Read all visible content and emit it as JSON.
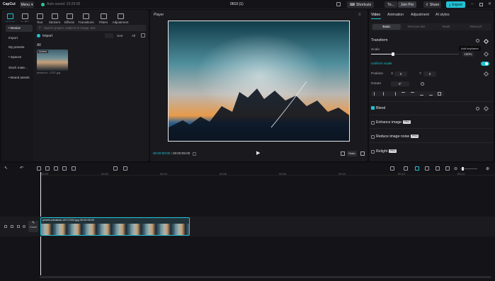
{
  "app": {
    "name": "CapCut",
    "menu_label": "Menu",
    "autosave": "Auto saved: 23:29:55",
    "project_title": "0610 (1)"
  },
  "topbar": {
    "shortcuts": "Shortcuts",
    "account": "To...",
    "join_pro": "Join Pro",
    "share": "Share",
    "export": "Export"
  },
  "media_tabs": [
    {
      "label": "Import"
    },
    {
      "label": "Audio"
    },
    {
      "label": "Text"
    },
    {
      "label": "Stickers"
    },
    {
      "label": "Effects"
    },
    {
      "label": "Transitions"
    },
    {
      "label": "Filters"
    },
    {
      "label": "Adjustment"
    }
  ],
  "sidebar": {
    "items": [
      "• Device",
      "Import",
      "My presets",
      "• Spaces",
      "Stock mate...",
      "• Brand assets"
    ]
  },
  "media": {
    "search_placeholder": "Search project, subjects in image, text",
    "import_label": "Import",
    "sort_label": "Sort",
    "filter_label": "All",
    "section_label": "All",
    "asset_badge": "Added",
    "asset_name": "pexels-m...0707.jpg"
  },
  "player": {
    "title": "Player",
    "time_current": "00:00:00:00",
    "time_total": "00:00:05:00",
    "ratio_label": "Ratio"
  },
  "props": {
    "tabs": [
      "Video",
      "Animation",
      "Adjustment",
      "AI styles"
    ],
    "subtabs": [
      "Basic",
      "Remove BG",
      "Mask",
      "Retouch"
    ],
    "transform_label": "Transform",
    "tooltip": "Add keyframe",
    "scale_label": "Scale",
    "scale_value": "100%",
    "scale_fraction": 0.25,
    "uniform_scale_label": "Uniform scale",
    "position_label": "Position",
    "pos_x": "0",
    "pos_y": "0",
    "pos_x_axis": "X",
    "pos_y_axis": "Y",
    "rotate_label": "Rotate",
    "rotate_value": "0°",
    "blend_label": "Blend",
    "enhance_label": "Enhance image",
    "noise_label": "Reduce image noise",
    "relight_label": "Relight",
    "pro_badge": "PRO"
  },
  "timeline": {
    "ruler": [
      "00:00",
      "00:02",
      "00:04",
      "00:06",
      "00:08",
      "00:10",
      "00:12",
      "00:14"
    ],
    "cover_label": "Cover",
    "clip_name": "pexels-minakolo-20717262.jpg",
    "clip_duration": "00:00:05:00"
  },
  "colors": {
    "accent": "#20c3d4",
    "bg": "#0f0f12",
    "panel": "#1a1a1e"
  }
}
